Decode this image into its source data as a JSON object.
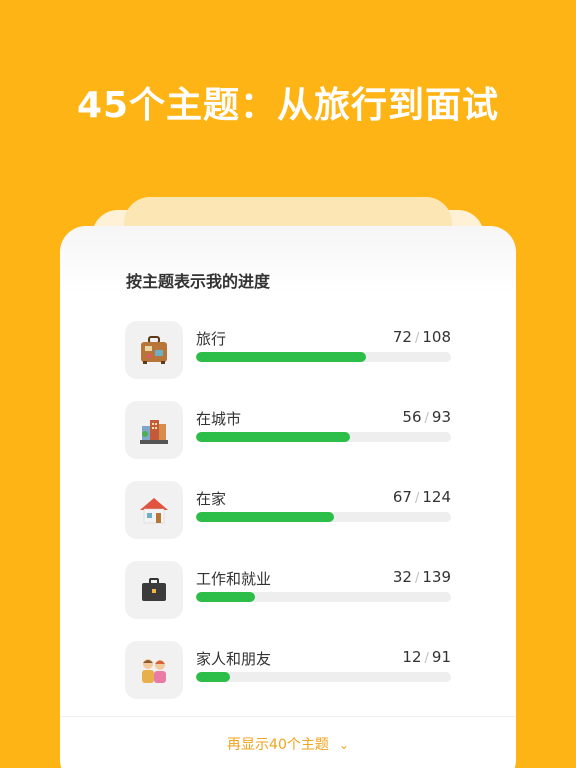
{
  "headline": "45个主题：从旅行到面试",
  "card": {
    "title": "按主题表示我的进度",
    "topics": [
      {
        "label": "旅行",
        "done": "72",
        "total": "108",
        "progress": 0.667,
        "icon": "suitcase-icon"
      },
      {
        "label": "在城市",
        "done": "56",
        "total": "93",
        "progress": 0.602,
        "icon": "city-icon"
      },
      {
        "label": "在家",
        "done": "67",
        "total": "124",
        "progress": 0.54,
        "icon": "house-icon"
      },
      {
        "label": "工作和就业",
        "done": "32",
        "total": "139",
        "progress": 0.23,
        "icon": "briefcase-icon"
      },
      {
        "label": "家人和朋友",
        "done": "12",
        "total": "91",
        "progress": 0.132,
        "icon": "family-icon"
      }
    ],
    "show_more": "再显示40个主题"
  },
  "colors": {
    "background": "#FFB416",
    "progress": "#2DBE4A",
    "link": "#F2A31D"
  }
}
